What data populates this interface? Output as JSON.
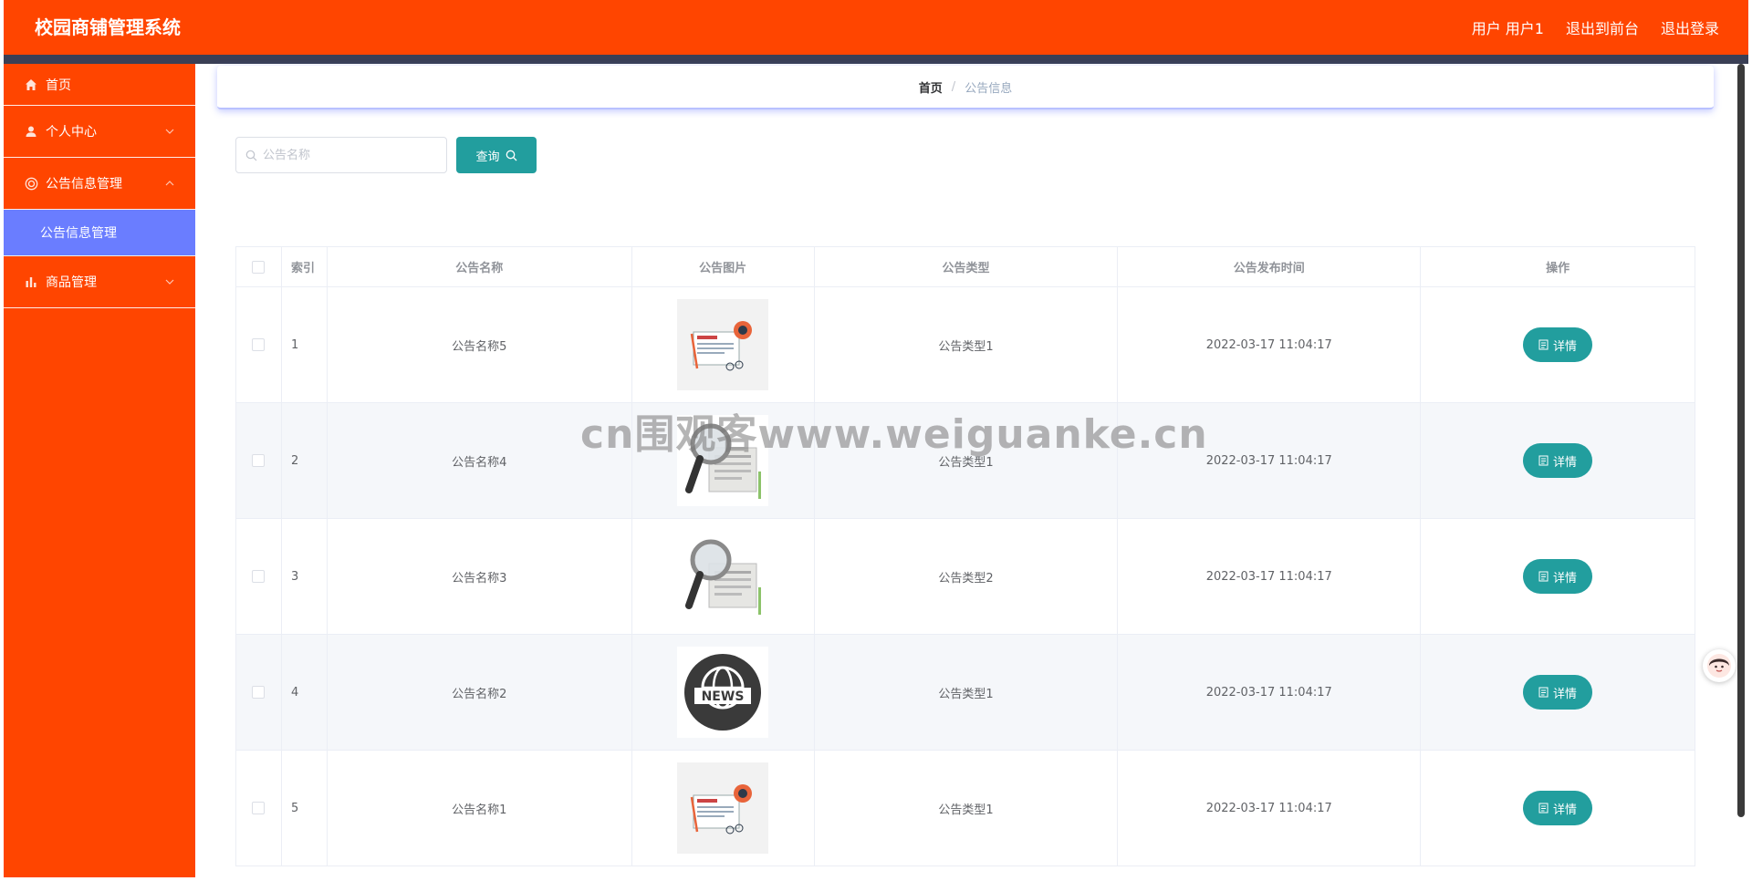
{
  "header": {
    "brand": "校园商铺管理系统",
    "user_label": "用户 用户1",
    "to_front_label": "退出到前台",
    "logout_label": "退出登录"
  },
  "sidebar": {
    "items": [
      {
        "label": "首页",
        "icon": "home-icon"
      },
      {
        "label": "个人中心",
        "icon": "user-icon"
      },
      {
        "label": "公告信息管理",
        "icon": "notice-icon",
        "expanded": true,
        "children": [
          {
            "label": "公告信息管理",
            "active": true
          }
        ]
      },
      {
        "label": "商品管理",
        "icon": "chart-icon"
      }
    ]
  },
  "breadcrumb": {
    "home": "首页",
    "separator": "/",
    "current": "公告信息"
  },
  "search": {
    "placeholder": "公告名称",
    "value": "",
    "button_label": "查询"
  },
  "table": {
    "columns": [
      "索引",
      "公告名称",
      "公告图片",
      "公告类型",
      "公告发布时间",
      "操作"
    ],
    "rows": [
      {
        "index": "1",
        "name": "公告名称5",
        "image": "news-desk-illustration",
        "type": "公告类型1",
        "time": "2022-03-17 11:04:17",
        "action": "详情"
      },
      {
        "index": "2",
        "name": "公告名称4",
        "image": "news-magnifier-illustration",
        "type": "公告类型1",
        "time": "2022-03-17 11:04:17",
        "action": "详情"
      },
      {
        "index": "3",
        "name": "公告名称3",
        "image": "news-magnifier-illustration",
        "type": "公告类型2",
        "time": "2022-03-17 11:04:17",
        "action": "详情"
      },
      {
        "index": "4",
        "name": "公告名称2",
        "image": "news-globe-badge",
        "type": "公告类型1",
        "time": "2022-03-17 11:04:17",
        "action": "详情"
      },
      {
        "index": "5",
        "name": "公告名称1",
        "image": "news-desk-illustration",
        "type": "公告类型1",
        "time": "2022-03-17 11:04:17",
        "action": "详情"
      }
    ]
  },
  "watermark": "cn围观客www.weiguanke.cn",
  "colors": {
    "header_bg": "#ff4500",
    "header_strip": "#3a3f55",
    "active_submenu": "#6a7dff",
    "primary_button": "#229e9e"
  }
}
